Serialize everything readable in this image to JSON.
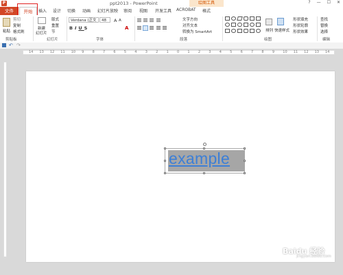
{
  "window": {
    "title": "ppt2013 - PowerPoint",
    "contextual_tab": "绘图工具",
    "controls": [
      "?",
      "—",
      "☐",
      "✕"
    ]
  },
  "tabs": {
    "file": "文件",
    "home": "开始",
    "items": [
      "插入",
      "设计",
      "切换",
      "动画",
      "幻灯片放映",
      "审阅",
      "视图",
      "开发工具",
      "ACROBAT",
      "格式"
    ]
  },
  "ribbon": {
    "clipboard": {
      "paste": "粘贴",
      "cut": "剪切",
      "copy": "复制",
      "format_painter": "格式刷",
      "label": "剪贴板"
    },
    "slides": {
      "new_slide": "新建",
      "new_slide_2": "幻灯片",
      "layout": "版式",
      "reset": "重置",
      "section": "节",
      "label": "幻灯片"
    },
    "font": {
      "family": "Verdana (正文",
      "size": "48",
      "label": "字体"
    },
    "paragraph": {
      "text_direction": "文字方向",
      "align_text": "对齐文本",
      "smartart": "转换为 SmartArt",
      "label": "段落"
    },
    "drawing": {
      "arrange": "排列",
      "quick_styles": "快速样式",
      "shape_fill": "形状填充",
      "shape_outline": "形状轮廓",
      "shape_effects": "形状效果",
      "label": "绘图"
    },
    "editing": {
      "find": "查找",
      "replace": "替换",
      "select": "选择",
      "label": "编辑"
    }
  },
  "ruler": {
    "ticks": [
      "14",
      "13",
      "12",
      "11",
      "10",
      "9",
      "8",
      "7",
      "6",
      "5",
      "4",
      "3",
      "2",
      "1",
      "0",
      "1",
      "2",
      "3",
      "4",
      "5",
      "6",
      "7",
      "8",
      "9",
      "10",
      "11",
      "12",
      "13",
      "14"
    ]
  },
  "slide": {
    "text": "example"
  },
  "watermark": {
    "main": "Baidu 经验",
    "sub": "jingyan.baidu.com"
  }
}
